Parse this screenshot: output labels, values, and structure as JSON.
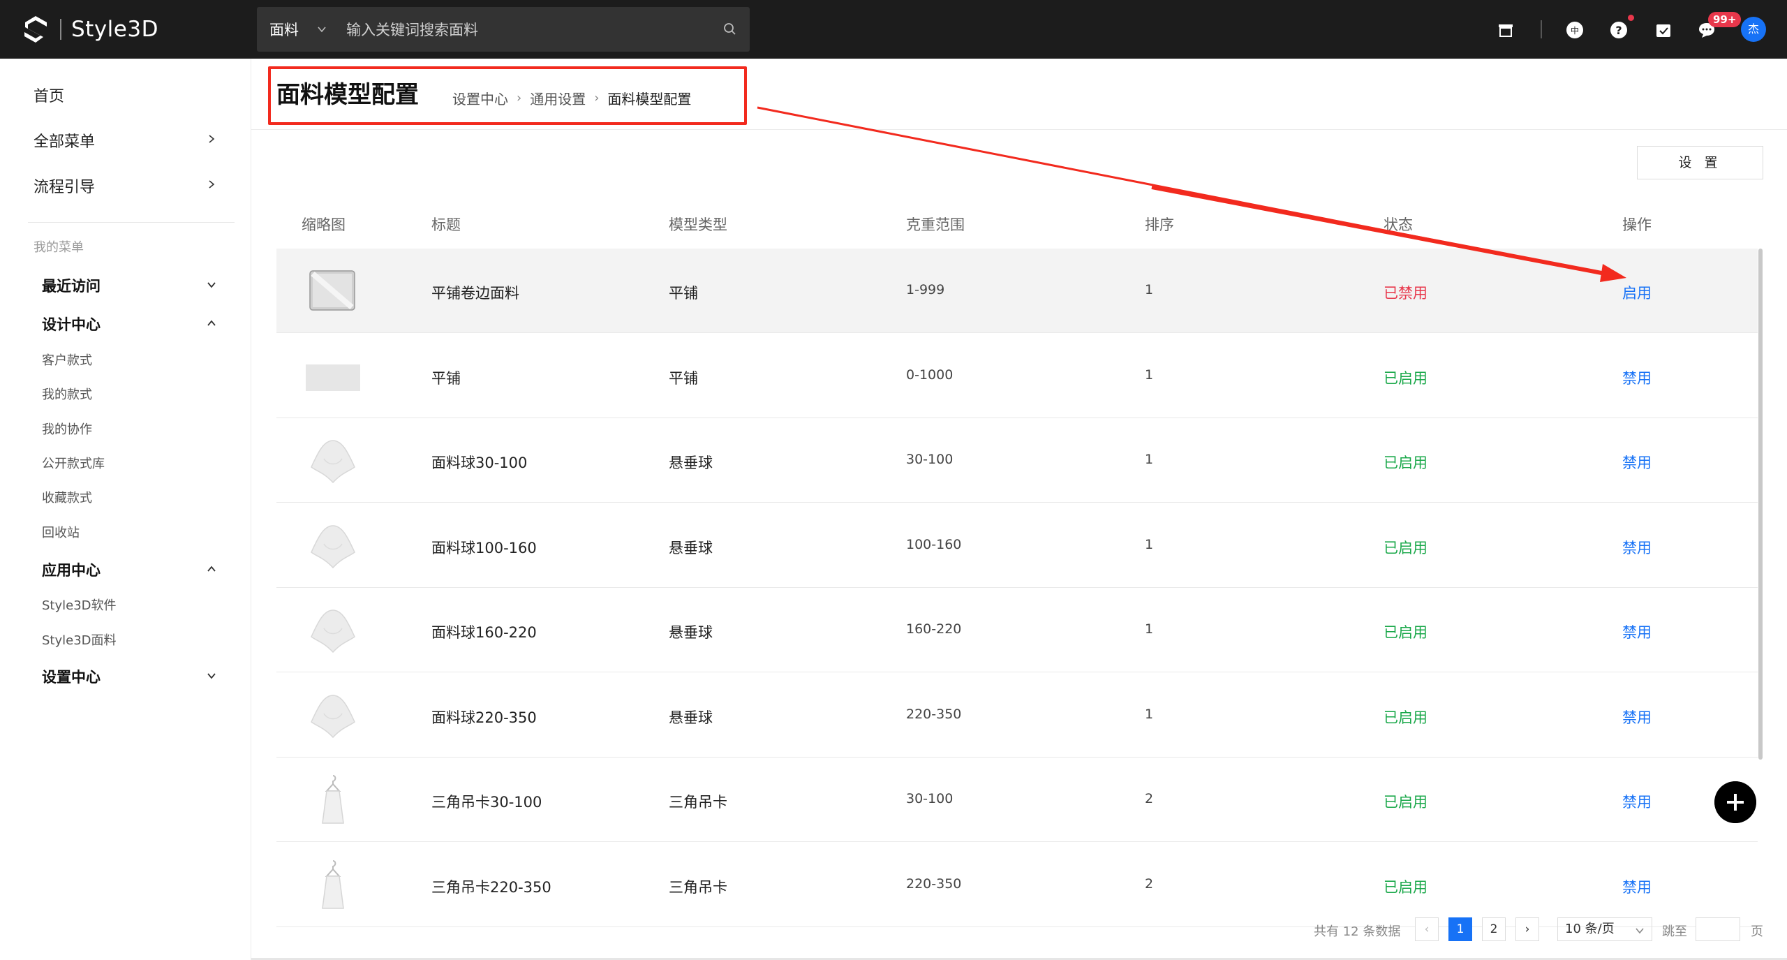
{
  "app": {
    "name": "Style3D"
  },
  "search": {
    "category": "面料",
    "placeholder": "输入关键词搜索面料"
  },
  "topbar": {
    "notification_badge": "99+",
    "avatar_initial": "杰"
  },
  "sidebar": {
    "top_items": [
      {
        "label": "首页"
      },
      {
        "label": "全部菜单"
      },
      {
        "label": "流程引导"
      }
    ],
    "my_menu_caption": "我的菜单",
    "groups": {
      "recent": "最近访问",
      "design": "设计中心",
      "design_items": [
        "客户款式",
        "我的款式",
        "我的协作",
        "公开款式库",
        "收藏款式",
        "回收站"
      ],
      "apps": "应用中心",
      "apps_items": [
        "Style3D软件",
        "Style3D面料"
      ],
      "settings": "设置中心"
    }
  },
  "header": {
    "title": "面料模型配置",
    "breadcrumb": [
      "设置中心",
      "通用设置",
      "面料模型配置"
    ]
  },
  "toolbar": {
    "settings_label": "设 置"
  },
  "table": {
    "columns": [
      "缩略图",
      "标题",
      "模型类型",
      "克重范围",
      "排序",
      "状态",
      "操作"
    ],
    "rows": [
      {
        "title": "平铺卷边面料",
        "type": "平铺",
        "range": "1-999",
        "order": "1",
        "status": "已禁用",
        "action": "启用",
        "thumb": "curled-flat"
      },
      {
        "title": "平铺",
        "type": "平铺",
        "range": "0-1000",
        "order": "1",
        "status": "已启用",
        "action": "禁用",
        "thumb": "flat"
      },
      {
        "title": "面料球30-100",
        "type": "悬垂球",
        "range": "30-100",
        "order": "1",
        "status": "已启用",
        "action": "禁用",
        "thumb": "drape-ball"
      },
      {
        "title": "面料球100-160",
        "type": "悬垂球",
        "range": "100-160",
        "order": "1",
        "status": "已启用",
        "action": "禁用",
        "thumb": "drape-ball"
      },
      {
        "title": "面料球160-220",
        "type": "悬垂球",
        "range": "160-220",
        "order": "1",
        "status": "已启用",
        "action": "禁用",
        "thumb": "drape-ball"
      },
      {
        "title": "面料球220-350",
        "type": "悬垂球",
        "range": "220-350",
        "order": "1",
        "status": "已启用",
        "action": "禁用",
        "thumb": "drape-ball"
      },
      {
        "title": "三角吊卡30-100",
        "type": "三角吊卡",
        "range": "30-100",
        "order": "2",
        "status": "已启用",
        "action": "禁用",
        "thumb": "hanger"
      },
      {
        "title": "三角吊卡220-350",
        "type": "三角吊卡",
        "range": "220-350",
        "order": "2",
        "status": "已启用",
        "action": "禁用",
        "thumb": "hanger"
      }
    ]
  },
  "pagination": {
    "total_text": "共有 12 条数据",
    "pages": [
      "1",
      "2"
    ],
    "current": "1",
    "page_size": "10 条/页",
    "jump_label": "跳至",
    "page_suffix": "页"
  },
  "colors": {
    "topbar_bg": "#1c1c1c",
    "accent": "#1772f6",
    "disabled_status": "#e8374b",
    "enabled_status": "#1aa84a",
    "annotation": "#f22a1e"
  }
}
